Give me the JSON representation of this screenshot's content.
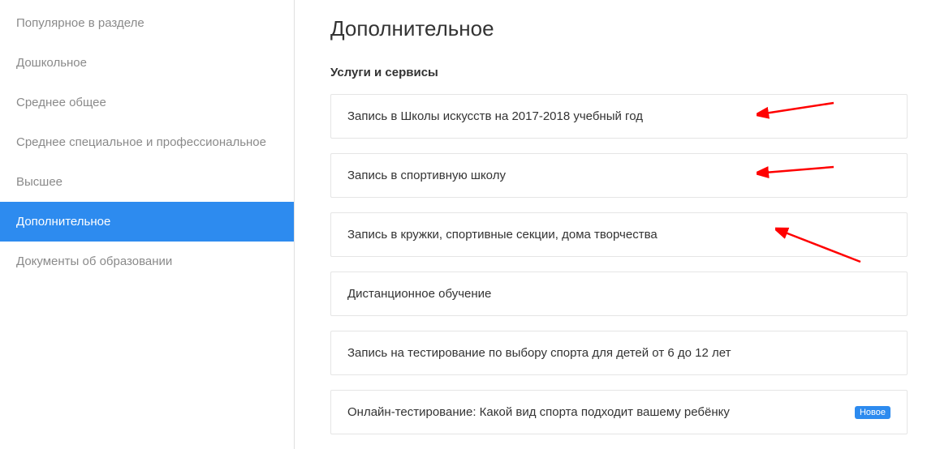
{
  "sidebar": {
    "items": [
      {
        "label": "Популярное в разделе",
        "active": false
      },
      {
        "label": "Дошкольное",
        "active": false
      },
      {
        "label": "Среднее общее",
        "active": false
      },
      {
        "label": "Среднее специальное и профессиональное",
        "active": false
      },
      {
        "label": "Высшее",
        "active": false
      },
      {
        "label": "Дополнительное",
        "active": true
      },
      {
        "label": "Документы об образовании",
        "active": false
      }
    ]
  },
  "main": {
    "title": "Дополнительное",
    "section_title": "Услуги и сервисы",
    "services": [
      {
        "label": "Запись в Школы искусств на 2017-2018 учебный год",
        "badge": null
      },
      {
        "label": "Запись в спортивную школу",
        "badge": null
      },
      {
        "label": "Запись в кружки, спортивные секции, дома творчества",
        "badge": null
      },
      {
        "label": "Дистанционное обучение",
        "badge": null
      },
      {
        "label": "Запись на тестирование по выбору спорта для детей от 6 до 12 лет",
        "badge": null
      },
      {
        "label": "Онлайн-тестирование: Какой вид спорта подходит вашему ребёнку",
        "badge": "Новое"
      }
    ]
  },
  "colors": {
    "accent": "#2d8bef",
    "text_muted": "#8a8a8a",
    "text": "#333333",
    "border": "#e5e5e5",
    "arrow": "#ff0000"
  }
}
